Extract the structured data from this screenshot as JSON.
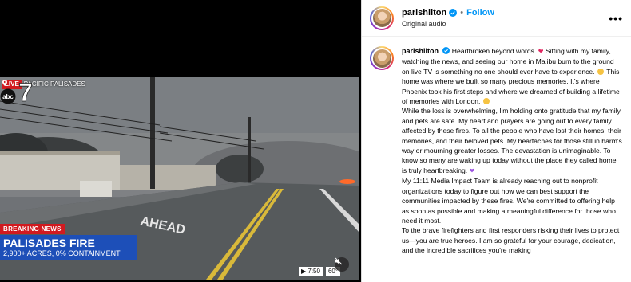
{
  "video": {
    "live_label": "LIVE",
    "location": "PACIFIC PALISADES",
    "breaking_label": "BREAKING NEWS",
    "headline": "PALISADES FIRE",
    "subline": "2,900+ ACRES, 0% CONTAINMENT",
    "time": "7:50",
    "temperature": "60°",
    "road_text": "AHEAD",
    "station_logo": "abc 7"
  },
  "header": {
    "username": "parishilton",
    "separator": "•",
    "follow_label": "Follow",
    "audio_label": "Original audio",
    "more_label": "•••"
  },
  "caption": {
    "username": "parishilton",
    "p1_a": "Heartbroken beyond words.",
    "p1_b": "Sitting with my family, watching the news, and seeing our home in Malibu burn to the ground on live TV is something no one should ever have to experience.",
    "p1_c": "This home was where we built so many precious memories. It's where Phoenix took his first steps and where we dreamed of building a lifetime of memories with London.",
    "p2_a": "While the loss is overwhelming, I'm holding onto gratitude that my family and pets are safe. My heart and prayers are going out to every family affected by these fires. To all the people who have lost their homes, their memories, and their beloved pets. My heartaches for those still in harm's way or mourning greater losses. The devastation is unimaginable. To know so many are waking up today without the place they called home is truly heartbreaking.",
    "p3": "My 11:11 Media Impact Team is already reaching out to nonprofit organizations today to figure out how we can best support the communities impacted by these fires. We're committed to offering help as soon as possible and making a meaningful difference for those who need it most.",
    "p4": "To the brave firefighters and first responders risking their lives to protect us—you are true heroes. I am so grateful for your courage, dedication, and the incredible sacrifices you're making"
  },
  "colors": {
    "accent": "#0095f6",
    "verified": "#0095f6",
    "live_red": "#d11a20",
    "news_blue": "#1d4fb8"
  },
  "icons": [
    "verified-icon",
    "more-options-icon",
    "location-pin-icon",
    "mute-icon",
    "broken-heart-emoji",
    "sad-emoji",
    "crying-emoji",
    "purple-heart-emoji"
  ]
}
